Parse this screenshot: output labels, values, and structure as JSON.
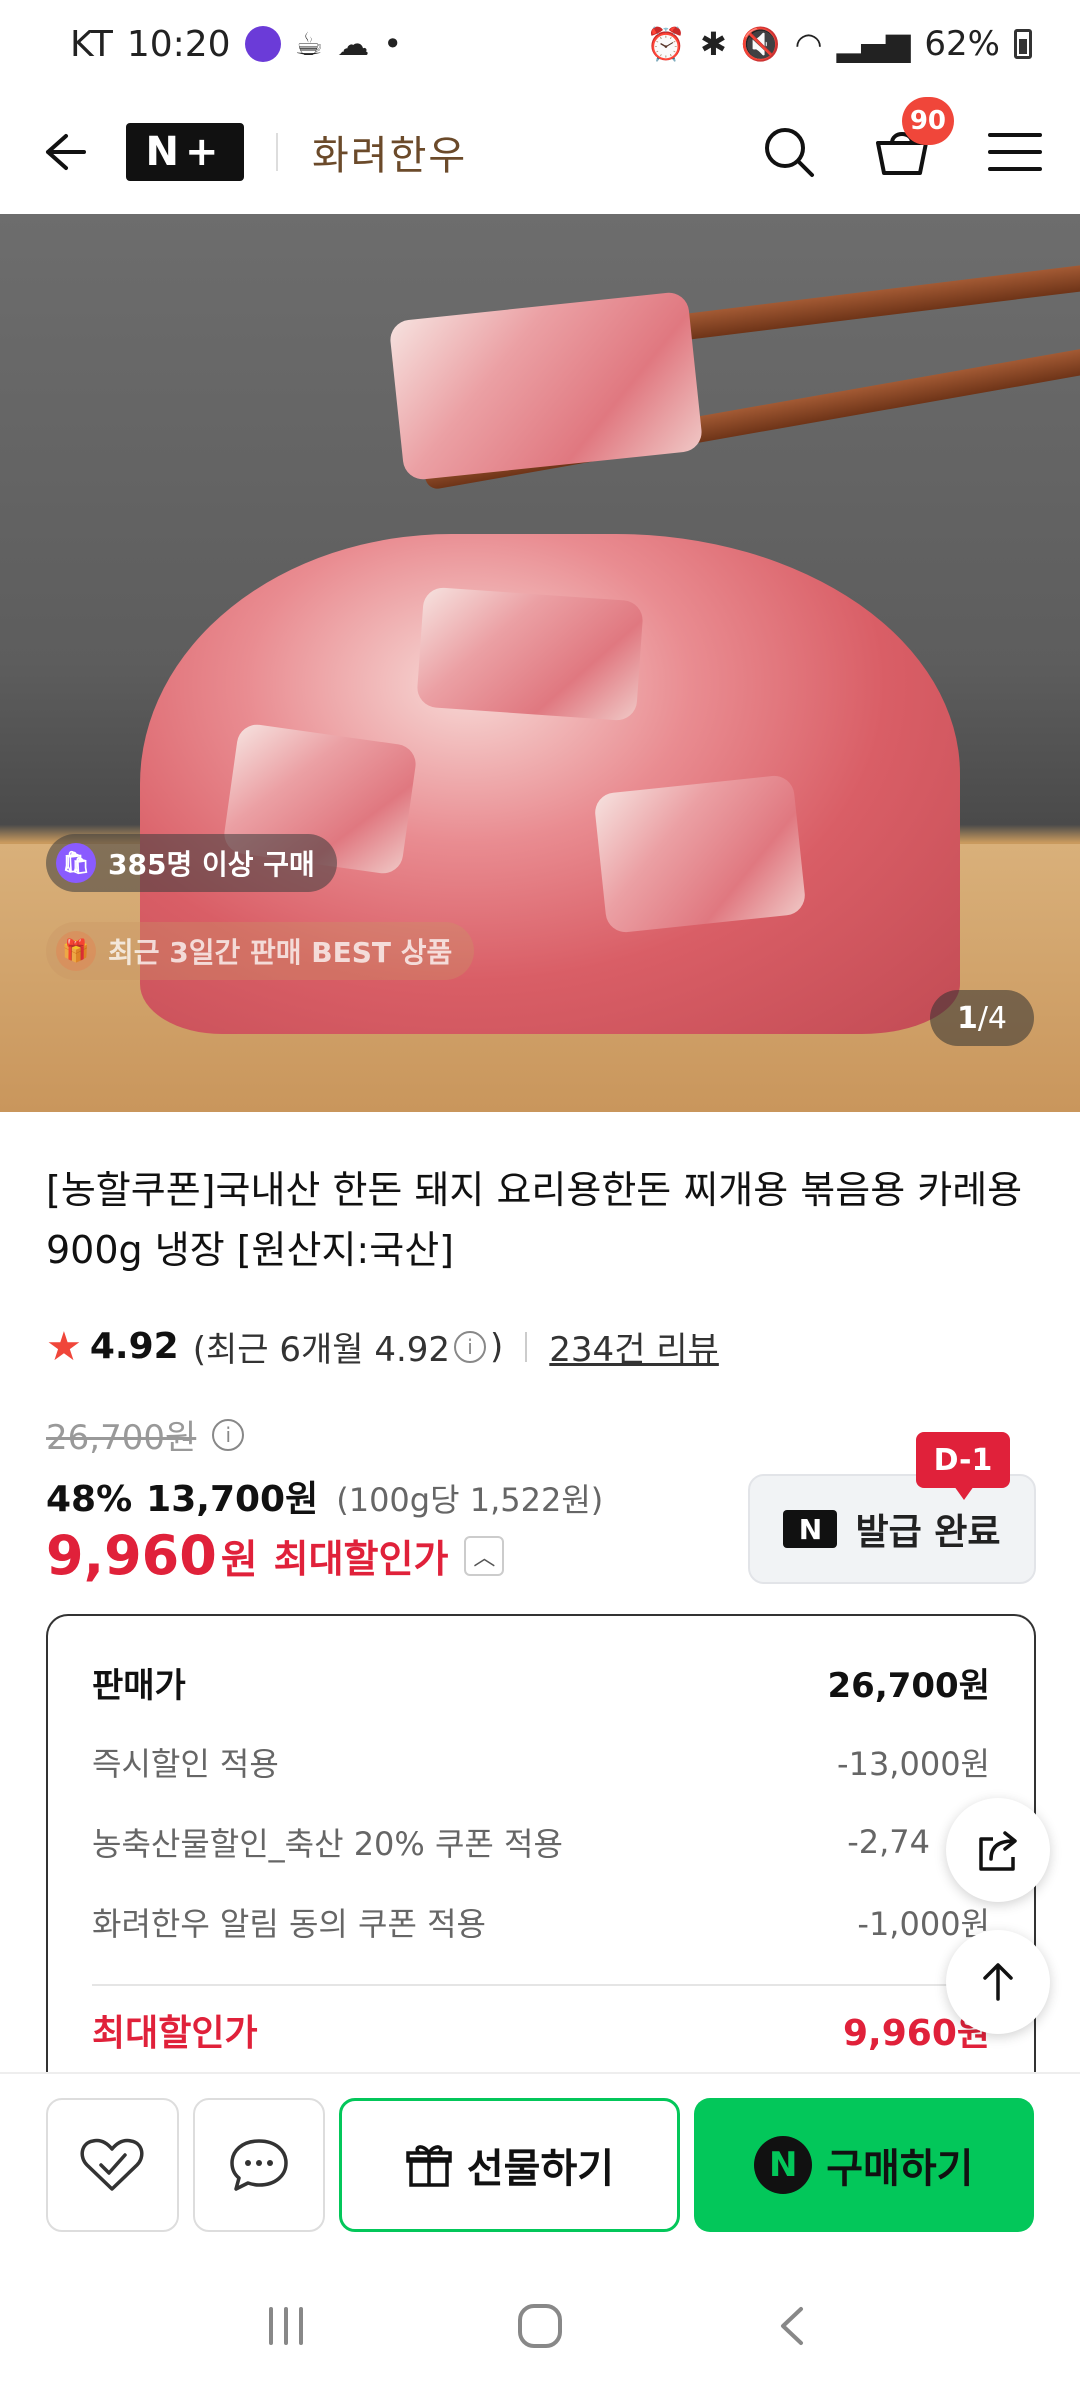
{
  "status_bar": {
    "carrier": "KT",
    "time": "10:20",
    "battery": "62%"
  },
  "header": {
    "brand_badge": "N+",
    "brand_name": "화려한우",
    "cart_count": "90"
  },
  "hero": {
    "chip_members": "385명 이상 구매",
    "chip_best": "최근 3일간 판매 BEST 상품",
    "counter_current": "1",
    "counter_total": "/4"
  },
  "product": {
    "title": "[농할쿠폰]국내산 한돈 돼지 요리용한돈 찌개용 볶음용 카레용 900g 냉장 [원산지:국산]",
    "rating": "4.92",
    "rating_recent": "(최근 6개월 4.92",
    "rating_close": ")",
    "review_count": "234건 리뷰",
    "original_price": "26,700원",
    "discount_rate": "48%",
    "sale_price": "13,700원",
    "unit_price": "(100g당 1,522원)",
    "max_price": "9,960",
    "max_won": "원",
    "max_label": "최대할인가"
  },
  "coupon": {
    "tag": "D-1",
    "label": "발급 완료",
    "logo": "N"
  },
  "breakdown": {
    "rows": [
      {
        "label": "판매가",
        "value": "26,700원"
      },
      {
        "label": "즉시할인 적용",
        "value": "-13,000원"
      },
      {
        "label": "농축산물할인_축산 20% 쿠폰 적용",
        "value": "-2,74"
      },
      {
        "label": "화려한우 알림 동의 쿠폰 적용",
        "value": "-1,000원"
      }
    ],
    "total_label": "최대할인가",
    "total_value": "9,960원"
  },
  "actions": {
    "gift_label": "선물하기",
    "buy_label": "구매하기",
    "buy_logo": "N"
  },
  "colors": {
    "accent_red": "#e0213a",
    "naver_green": "#03c75a",
    "badge_red": "#f0463a"
  }
}
